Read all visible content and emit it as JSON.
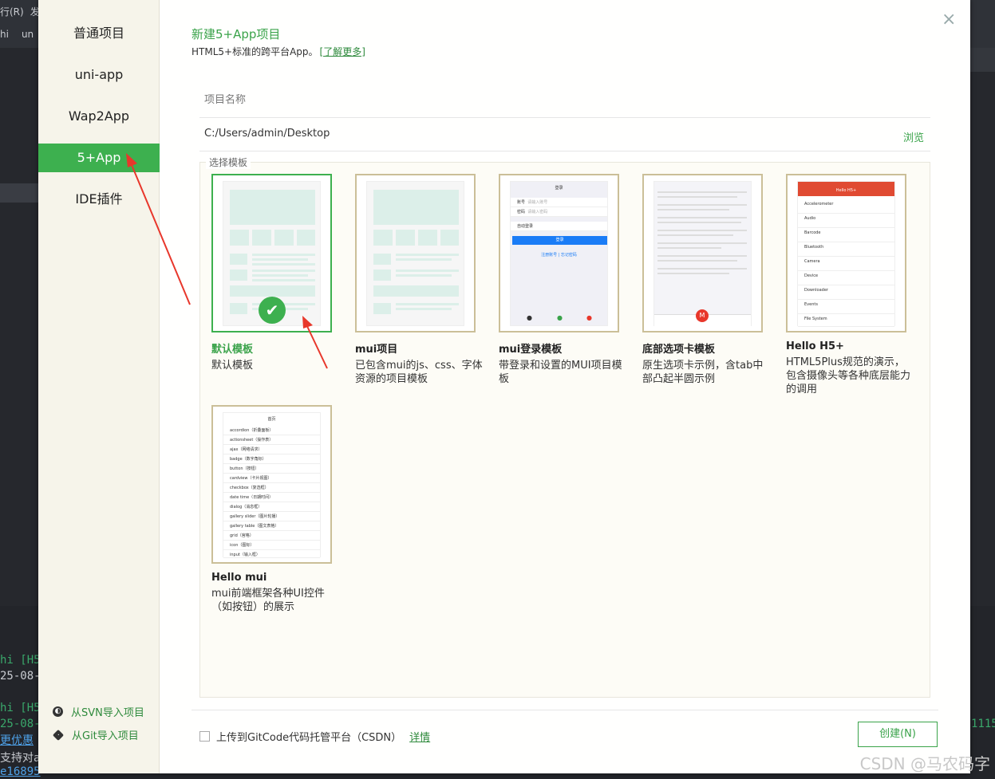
{
  "background": {
    "menu": [
      "行(R)",
      "发"
    ],
    "path": [
      "hi",
      "un"
    ],
    "console": [
      "hi [H5",
      "25-08-",
      "hi [H5",
      "25-08-",
      "更优惠",
      "支持对ap",
      "e16895"
    ],
    "console_right": "1115"
  },
  "sidebar": {
    "items": [
      {
        "label": "普通项目"
      },
      {
        "label": "uni-app"
      },
      {
        "label": "Wap2App"
      },
      {
        "label": "5+App"
      },
      {
        "label": "IDE插件"
      }
    ],
    "svn_link": "从SVN导入项目",
    "git_link": "从Git导入项目"
  },
  "header": {
    "title": "新建5+App项目",
    "subtitle": "HTML5+标准的跨平台App。",
    "learn_more": "[了解更多]"
  },
  "form": {
    "name_placeholder": "项目名称",
    "path_value": "C:/Users/admin/Desktop",
    "browse_label": "浏览"
  },
  "templates": {
    "legend": "选择模板",
    "items": [
      {
        "name": "默认模板",
        "desc": "默认模板"
      },
      {
        "name": "mui项目",
        "desc": "已包含mui的js、css、字体资源的项目模板"
      },
      {
        "name": "mui登录模板",
        "desc": "带登录和设置的MUI项目模板"
      },
      {
        "name": "底部选项卡模板",
        "desc": "原生选项卡示例，含tab中部凸起半圆示例"
      },
      {
        "name": "Hello H5+",
        "desc": "HTML5Plus规范的演示，包含摄像头等各种底层能力的调用"
      },
      {
        "name": "Hello mui",
        "desc": "mui前端框架各种UI控件（如按钮）的展示"
      }
    ],
    "login_preview": {
      "header": "登录",
      "account": "账号",
      "account_ph": "请输入账号",
      "password": "密码",
      "password_ph": "请输入密码",
      "auto_login": "自动登录",
      "button": "登录",
      "links": "注册账号 | 忘记密码"
    },
    "h5_preview": {
      "header": "Hello H5+",
      "rows": [
        "Accelerometer",
        "Audio",
        "Barcode",
        "Bluetooth",
        "Camera",
        "Device",
        "Downloader",
        "Events",
        "File System"
      ]
    },
    "mui_preview": {
      "header": "首页",
      "rows": [
        "accordion（折叠面板）",
        "actionsheet（操作表）",
        "ajax（网络请求）",
        "badge（数字角标）",
        "button（按钮）",
        "cardview（卡片视图）",
        "checkbox（复选框）",
        "date time（日期时间）",
        "dialog（消息框）",
        "gallery slider（图片轮播）",
        "gallery table（图文表格）",
        "grid（宫格）",
        "icon（图标）",
        "input（输入框）"
      ]
    }
  },
  "footer": {
    "upload_label": "上传到GitCode代码托管平台（CSDN）",
    "details_link": "详情",
    "create_button": "创建(N)"
  },
  "watermark": "CSDN @马农码字",
  "icons": {
    "check": "check-icon",
    "close": "close-icon",
    "svn": "svn-icon",
    "git": "git-icon"
  },
  "colors": {
    "accent": "#3db04f",
    "sidebar_bg": "#f6f4ea",
    "arrow": "#e8372b"
  }
}
